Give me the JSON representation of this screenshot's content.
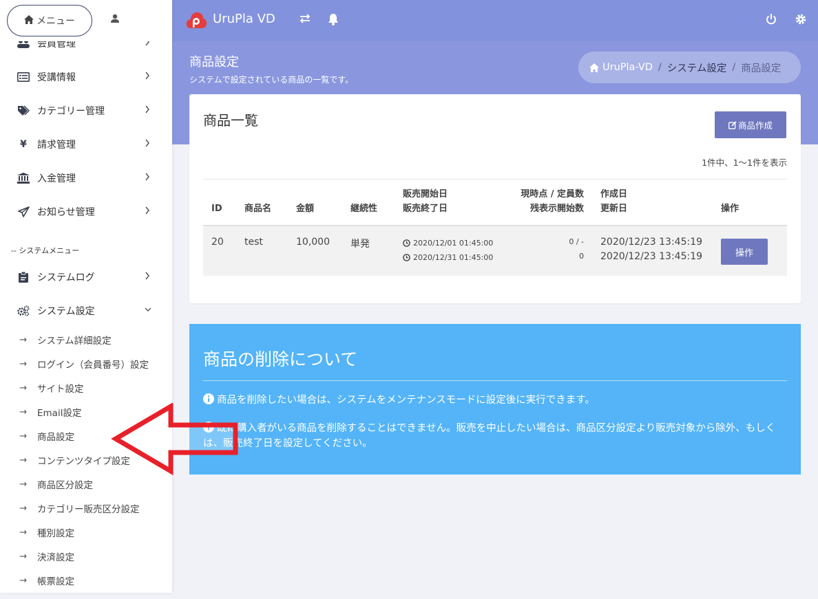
{
  "sidebar": {
    "menu_button": "メニュー",
    "items": [
      {
        "label": "会員管理",
        "icon": "users-icon"
      },
      {
        "label": "受講情報",
        "icon": "list-icon"
      },
      {
        "label": "カテゴリー管理",
        "icon": "tags-icon"
      },
      {
        "label": "請求管理",
        "icon": "yen-icon"
      },
      {
        "label": "入金管理",
        "icon": "bank-icon"
      },
      {
        "label": "お知らせ管理",
        "icon": "paper-plane-icon"
      }
    ],
    "system_section": "-- システムメニュー",
    "system_items": [
      {
        "label": "システムログ",
        "icon": "clipboard-icon"
      },
      {
        "label": "システム設定",
        "icon": "cogs-icon"
      }
    ],
    "sub_items": [
      "システム詳細設定",
      "ログイン（会員番号）設定",
      "サイト設定",
      "Email設定",
      "商品設定",
      "コンテンツタイプ設定",
      "商品区分設定",
      "カテゴリー販売区分設定",
      "種別設定",
      "決済設定",
      "帳票設定"
    ],
    "sub_arrow": "→"
  },
  "header": {
    "app_title": "UruPla VD",
    "page_title": "商品設定",
    "page_subtitle": "システムで設定されている商品の一覧です。",
    "breadcrumb": [
      "UruPla-VD",
      "システム設定",
      "商品設定"
    ]
  },
  "card": {
    "title": "商品一覧",
    "create_button": "商品作成",
    "count_text": "1件中、1〜1件を表示",
    "columns": {
      "id": "ID",
      "name": "商品名",
      "price": "金額",
      "continuity": "継続性",
      "sale_start": "販売開始日",
      "sale_end": "販売終了日",
      "current_capacity": "現時点 / 定員数",
      "remaining_start": "残表示開始数",
      "created": "作成日",
      "updated": "更新日",
      "actions": "操作"
    },
    "rows": [
      {
        "id": "20",
        "name": "test",
        "price": "10,000",
        "continuity": "単発",
        "sale_start": "2020/12/01 01:45:00",
        "sale_end": "2020/12/31 01:45:00",
        "capacity": "0 / -",
        "remaining": "0",
        "created": "2020/12/23 13:45:19",
        "updated": "2020/12/23 13:45:19",
        "action_label": "操作"
      }
    ]
  },
  "info": {
    "title": "商品の削除について",
    "line1": "商品を削除したい場合は、システムをメンテナンスモードに設定後に実行できます。",
    "line2": "既に購入者がいる商品を削除することはできません。販売を中止したい場合は、商品区分設定より販売対象から除外、もしくは、販売終了日を設定してください。"
  },
  "colors": {
    "header_bg": "#8392dc",
    "primary_button": "#6f78bf",
    "info_bg": "#54b4f7",
    "annotation_arrow": "#e8202a",
    "logo": "#e53d3d"
  }
}
